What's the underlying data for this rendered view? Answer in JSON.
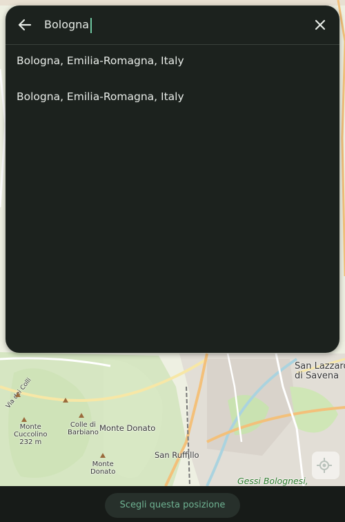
{
  "search": {
    "value": "Bologna",
    "back_icon": "arrow-left-icon",
    "clear_icon": "close-icon"
  },
  "results": [
    {
      "label": "Bologna, Emilia-Romagna, Italy"
    },
    {
      "label": "Bologna, Emilia-Romagna, Italy"
    }
  ],
  "map": {
    "labels": {
      "san_lazzaro": "San Lazzaro\ndi Savena",
      "via_dei_colli": "Via dei Colli",
      "colle_di_barbiano": "Colle di\nBarbiano",
      "monte_donato": "Monte Donato",
      "monte_cuccolino": "Monte\nCuccolino\n232 m",
      "monte_donato_peak": "Monte\nDonato",
      "san_ruffillo": "San Ruffillo",
      "gessi_bolognesi": "Gessi Bolognesi,"
    },
    "locate_icon": "crosshair-location-icon"
  },
  "bottom_bar": {
    "choose_label": "Scegli questa posizione"
  },
  "colors": {
    "panel_bg": "#1c221e",
    "accent": "#6fc7a0",
    "button_text": "#6fb393"
  }
}
